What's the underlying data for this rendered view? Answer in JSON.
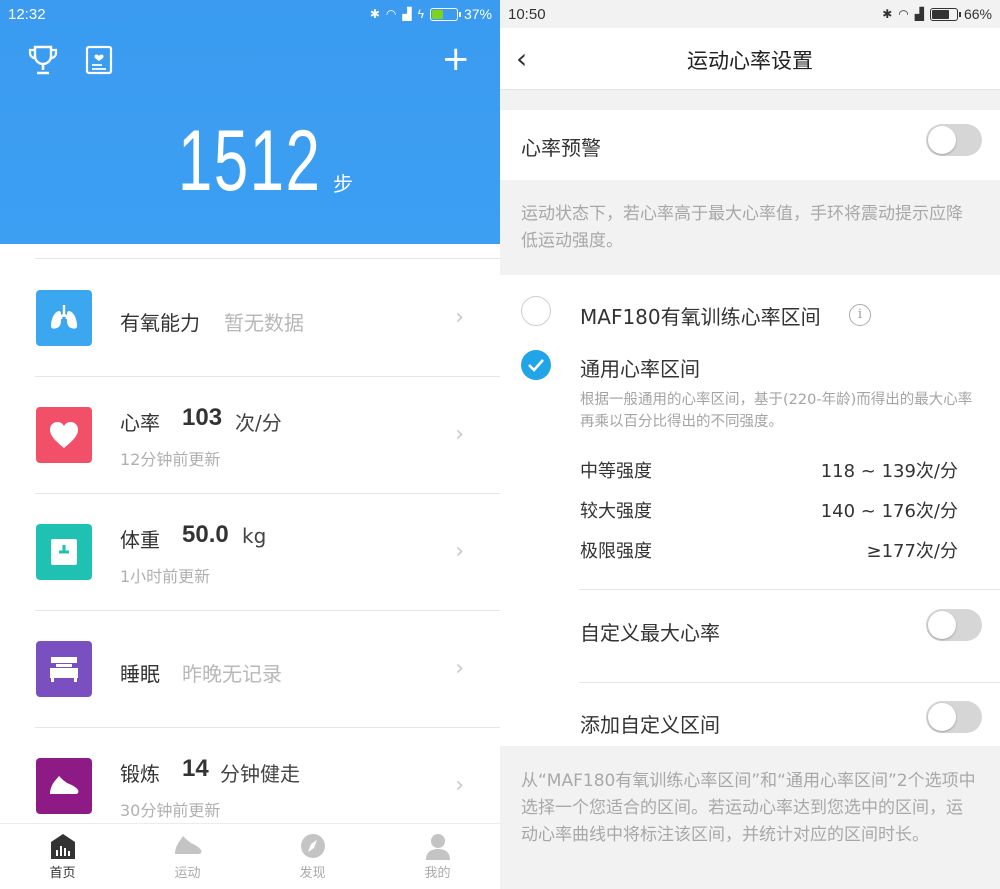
{
  "left": {
    "status": {
      "time": "12:32",
      "battery": "37%",
      "battery_color": "#7ed321"
    },
    "header": {
      "steps": "1512",
      "steps_unit": "步"
    },
    "items": [
      {
        "label": "有氧能力",
        "nodata": "暂无数据",
        "color": "#3aa7f0",
        "icon": "lungs-icon"
      },
      {
        "label": "心率",
        "value": "103",
        "unit": "次/分",
        "sub": "12分钟前更新",
        "color": "#f15068",
        "icon": "heart-icon"
      },
      {
        "label": "体重",
        "value": "50.0",
        "unit": "kg",
        "sub": "1小时前更新",
        "color": "#1fc1b2",
        "icon": "scale-icon"
      },
      {
        "label": "睡眠",
        "nodata": "昨晚无记录",
        "color": "#7a4fc0",
        "icon": "bed-icon"
      },
      {
        "label": "锻炼",
        "value": "14",
        "unit": "分钟健走",
        "sub": "30分钟前更新",
        "color": "#8e1a86",
        "icon": "shoe-icon"
      }
    ],
    "tabs": [
      {
        "label": "首页",
        "icon": "home-chart-icon"
      },
      {
        "label": "运动",
        "icon": "shoe-icon"
      },
      {
        "label": "发现",
        "icon": "compass-icon"
      },
      {
        "label": "我的",
        "icon": "person-icon"
      }
    ]
  },
  "right": {
    "status": {
      "time": "10:50",
      "battery": "66%"
    },
    "nav": {
      "title": "运动心率设置",
      "back": "‹"
    },
    "alert": {
      "label": "心率预警",
      "hint": "运动状态下，若心率高于最大心率值，手环将震动提示应降低运动强度。"
    },
    "options": {
      "maf_label": "MAF180有氧训练心率区间",
      "general_label": "通用心率区间",
      "general_desc": "根据一般通用的心率区间，基于(220-年龄)而得出的最大心率再乘以百分比得出的不同强度。",
      "zones": [
        {
          "name": "中等强度",
          "range": "118 ~ 139次/分"
        },
        {
          "name": "较大强度",
          "range": "140 ~ 176次/分"
        },
        {
          "name": "极限强度",
          "range": "≥177次/分"
        }
      ],
      "custom_max_label": "自定义最大心率",
      "custom_zone_label": "添加自定义区间"
    },
    "footer_hint": "从“MAF180有氧训练心率区间”和“通用心率区间”2个选项中选择一个您适合的区间。若运动心率达到您选中的区间，运动心率曲线中将标注该区间，并统计对应的区间时长。",
    "accent": "#22a4e8"
  }
}
